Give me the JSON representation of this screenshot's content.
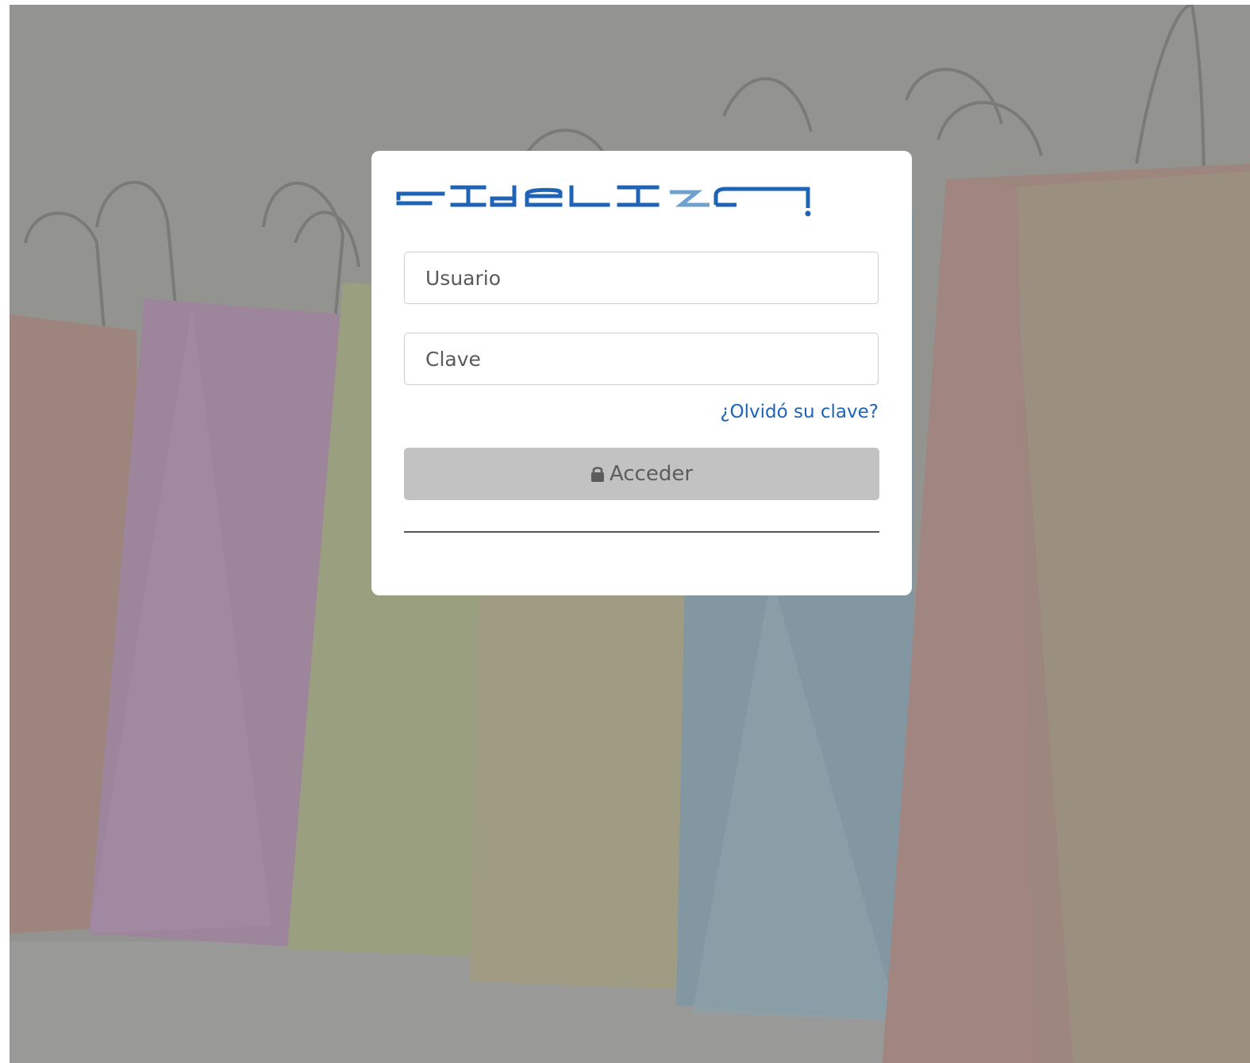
{
  "brand": {
    "logo_text": "FIDELIZA",
    "logo_color": "#1f63b5"
  },
  "login": {
    "username_placeholder": "Usuario",
    "password_placeholder": "Clave",
    "forgot_link": "¿Olvidó su clave?",
    "submit_label": "Acceder",
    "submit_icon": "lock-icon"
  },
  "colors": {
    "link": "#1f63b5",
    "button_bg": "#c2c2c2",
    "button_text": "#5c5c5c",
    "overlay": "#9a9a96"
  }
}
